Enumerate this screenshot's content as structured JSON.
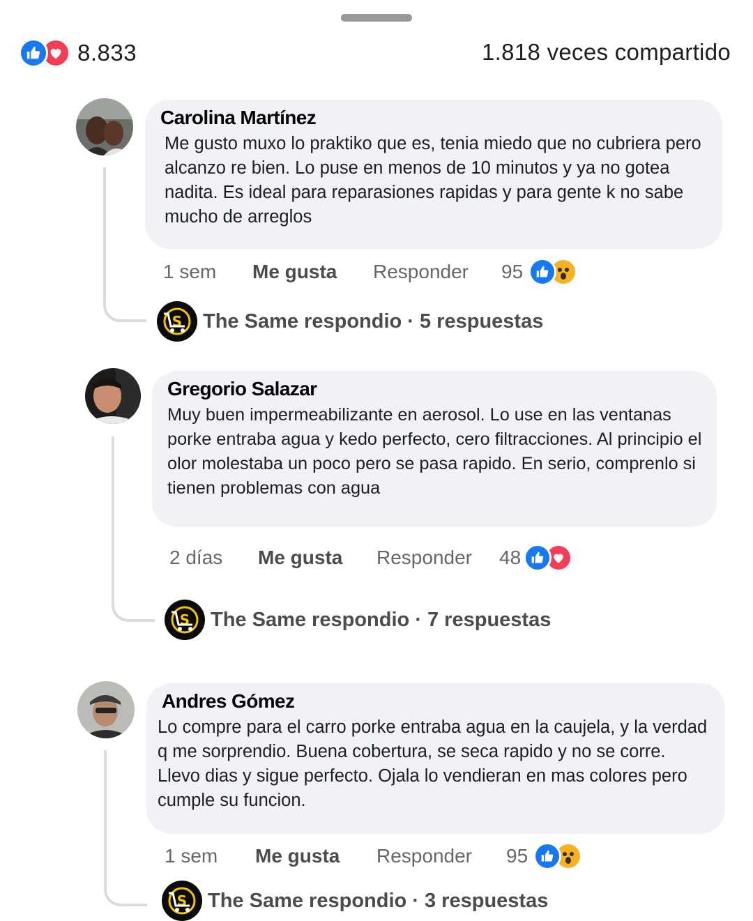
{
  "summary": {
    "reaction_count": "8.833",
    "shares": "1.818 veces compartido",
    "reactions": [
      "like-icon",
      "love-icon"
    ]
  },
  "labels": {
    "like": "Me gusta",
    "reply": "Responder"
  },
  "comments": [
    {
      "author": "Carolina Martínez",
      "text": "Me gusto muxo lo praktiko que es, tenia miedo que no cubriera pero alcanzo re bien. Lo puse en menos de 10 minutos y ya no gotea nadita. Es ideal para reparasiones rapidas y para gente k no sabe mucho de arreglos",
      "time": "1 sem",
      "reaction_count": "95",
      "reactions": [
        "like-icon",
        "wow-icon"
      ],
      "reply_summary": "The Same respondio · 5 respuestas"
    },
    {
      "author": "Gregorio Salazar",
      "text": "Muy buen impermeabilizante en aerosol. Lo use en las ventanas porke entraba agua y kedo perfecto, cero filtracciones. Al principio el olor molestaba un poco pero se pasa rapido. En serio, comprenlo si tienen problemas con agua",
      "time": "2 días",
      "reaction_count": "48",
      "reactions": [
        "like-icon",
        "love-icon"
      ],
      "reply_summary": "The Same respondio · 7 respuestas"
    },
    {
      "author": "Andres Gómez",
      "text": "Lo compre para el carro porke entraba agua en la caujela, y la verdad q me sorprendio. Buena cobertura, se seca rapido y no se corre. Llevo dias y sigue perfecto. Ojala lo vendieran en mas colores pero cumple su funcion.",
      "time": "1 sem",
      "reaction_count": "95",
      "reactions": [
        "like-icon",
        "wow-icon"
      ],
      "reply_summary": "The Same respondio · 3 respuestas"
    }
  ],
  "colors": {
    "like": "#1877f2",
    "love": "#f33e58",
    "wow": "#f7b125",
    "bubble": "#f0f2f5"
  }
}
